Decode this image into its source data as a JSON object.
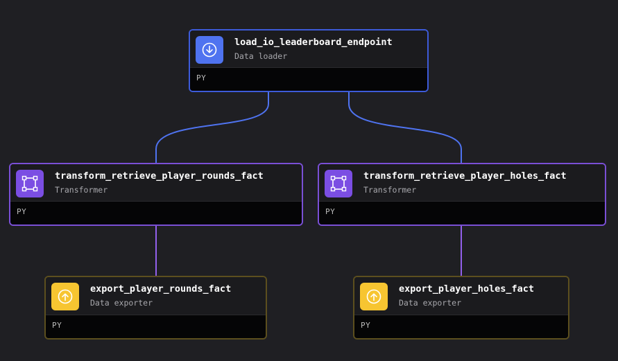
{
  "colors": {
    "background": "#1f1f23",
    "loader_accent": "#4f73f0",
    "transformer_accent": "#7b4ee3",
    "exporter_accent": "#f7c531",
    "edge_blue": "#4f73f0",
    "edge_purple": "#9360ec"
  },
  "nodes": {
    "loader": {
      "title": "load_io_leaderboard_endpoint",
      "type": "Data loader",
      "lang": "PY",
      "icon": "download-icon"
    },
    "transform_rounds": {
      "title": "transform_retrieve_player_rounds_fact",
      "type": "Transformer",
      "lang": "PY",
      "icon": "frame-icon"
    },
    "transform_holes": {
      "title": "transform_retrieve_player_holes_fact",
      "type": "Transformer",
      "lang": "PY",
      "icon": "frame-icon"
    },
    "export_rounds": {
      "title": "export_player_rounds_fact",
      "type": "Data exporter",
      "lang": "PY",
      "icon": "upload-icon"
    },
    "export_holes": {
      "title": "export_player_holes_fact",
      "type": "Data exporter",
      "lang": "PY",
      "icon": "upload-icon"
    }
  },
  "edges": [
    {
      "from": "load_io_leaderboard_endpoint",
      "to": "transform_retrieve_player_rounds_fact"
    },
    {
      "from": "load_io_leaderboard_endpoint",
      "to": "transform_retrieve_player_holes_fact"
    },
    {
      "from": "transform_retrieve_player_rounds_fact",
      "to": "export_player_rounds_fact"
    },
    {
      "from": "transform_retrieve_player_holes_fact",
      "to": "export_player_holes_fact"
    }
  ]
}
